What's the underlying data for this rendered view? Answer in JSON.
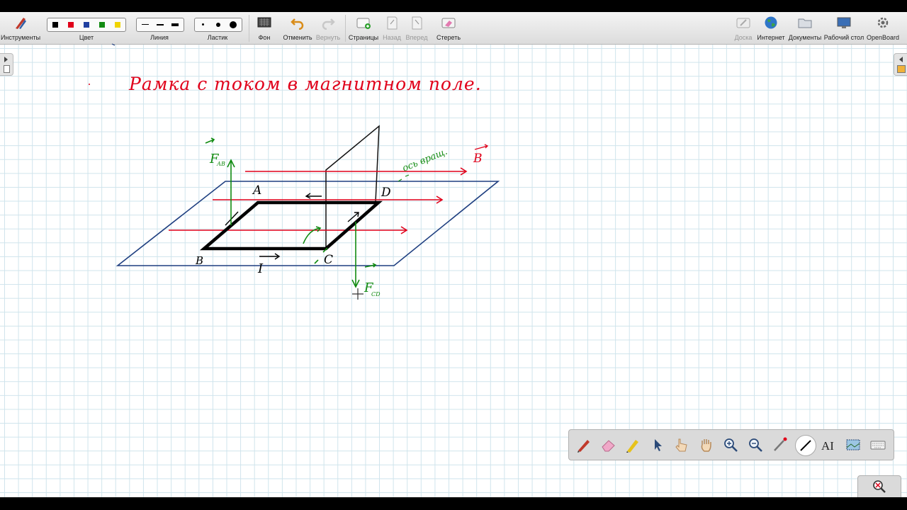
{
  "toolbar": {
    "tools_label": "Инструменты",
    "color_label": "Цвет",
    "line_label": "Линия",
    "eraser_label": "Ластик",
    "background_label": "Фон",
    "undo_label": "Отменить",
    "redo_label": "Вернуть",
    "pages_label": "Страницы",
    "back_label": "Назад",
    "forward_label": "Вперед",
    "erase_label": "Стереть",
    "board_label": "Доска",
    "internet_label": "Интернет",
    "documents_label": "Документы",
    "desktop_label": "Рабочий стол",
    "openboard_label": "OpenBoard"
  },
  "colors": {
    "palette": [
      "#000000",
      "#e0001a",
      "#1f3fa0",
      "#118a11",
      "#f0d400"
    ],
    "ink_red": "#e0001a",
    "ink_green": "#108a10",
    "ink_blue": "#1f3f80",
    "ink_black": "#000000"
  },
  "board": {
    "title": "Рамка с током в магнитном поле.",
    "labels": {
      "A": "A",
      "B": "B",
      "C": "C",
      "D": "D",
      "current": "I",
      "field": "B",
      "axis": "ось вращ.",
      "force_ab": "F",
      "force_ab_sub": "АВ",
      "force_cd": "F",
      "force_cd_sub": "CD"
    }
  },
  "stylus_tools": [
    "pen-icon",
    "eraser-icon",
    "marker-icon",
    "selector-icon",
    "interact-icon",
    "hand-icon",
    "zoom-in-icon",
    "zoom-out-icon",
    "laser-pointer-icon",
    "line-icon",
    "text-icon",
    "capture-icon",
    "keyboard-icon"
  ]
}
